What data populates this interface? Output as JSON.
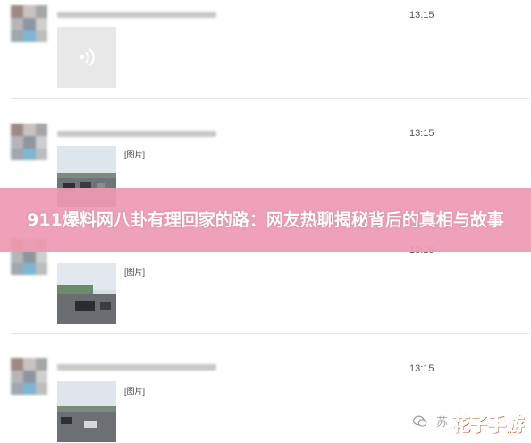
{
  "messages": [
    {
      "time": "13:15",
      "kind": "voice"
    },
    {
      "time": "13:15",
      "kind": "image",
      "tag": "[图片]"
    },
    {
      "time": "13:15",
      "kind": "image",
      "tag": "[图片]"
    },
    {
      "time": "13:15",
      "kind": "image",
      "tag": "[图片]"
    }
  ],
  "banner": {
    "title": "911爆料网八卦有理回家的路：网友热聊揭秘背后的真相与故事"
  },
  "watermark": {
    "text": "苏",
    "icon": "wechat-chat-icon",
    "logo": "花子手游"
  },
  "colors": {
    "banner": "#ee9ab2",
    "logo": "#ff7a1a"
  }
}
